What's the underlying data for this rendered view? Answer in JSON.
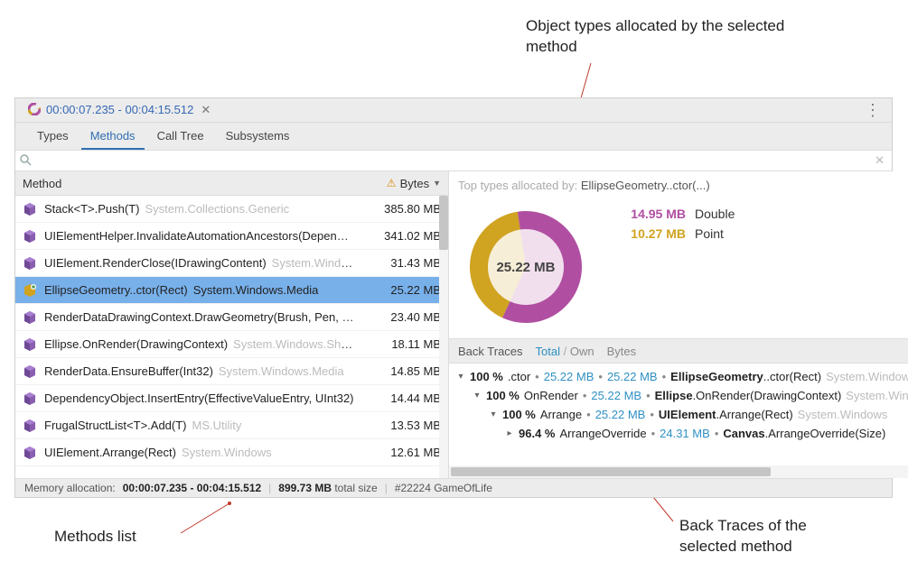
{
  "annotations": {
    "top_right": "Object types allocated by the selected method",
    "bottom_left": "Methods list",
    "bottom_right": "Back Traces of the selected method"
  },
  "tabstrip": {
    "title": "00:00:07.235 - 00:04:15.512"
  },
  "viewtabs": {
    "types": "Types",
    "methods": "Methods",
    "calltree": "Call Tree",
    "subsystems": "Subsystems"
  },
  "search": {
    "placeholder": ""
  },
  "grid_header": {
    "method": "Method",
    "bytes": "Bytes"
  },
  "methods": [
    {
      "name": "Stack<T>.Push(T)",
      "namespace": "System.Collections.Generic",
      "bytes": "385.80 MB",
      "selected": false
    },
    {
      "name": "UIElementHelper.InvalidateAutomationAncestors(DependencyObject)",
      "namespace": "",
      "bytes": "341.02 MB",
      "selected": false
    },
    {
      "name": "UIElement.RenderClose(IDrawingContent)",
      "namespace": "System.Windows",
      "bytes": "31.43 MB",
      "selected": false
    },
    {
      "name": "EllipseGeometry..ctor(Rect)",
      "namespace": "System.Windows.Media",
      "bytes": "25.22 MB",
      "selected": true
    },
    {
      "name": "RenderDataDrawingContext.DrawGeometry(Brush, Pen, Geometry)",
      "namespace": "",
      "bytes": "23.40 MB",
      "selected": false
    },
    {
      "name": "Ellipse.OnRender(DrawingContext)",
      "namespace": "System.Windows.Shapes",
      "bytes": "18.11 MB",
      "selected": false
    },
    {
      "name": "RenderData.EnsureBuffer(Int32)",
      "namespace": "System.Windows.Media",
      "bytes": "14.85 MB",
      "selected": false
    },
    {
      "name": "DependencyObject.InsertEntry(EffectiveValueEntry, UInt32)",
      "namespace": "",
      "bytes": "14.44 MB",
      "selected": false
    },
    {
      "name": "FrugalStructList<T>.Add(T)",
      "namespace": "MS.Utility",
      "bytes": "13.53 MB",
      "selected": false
    },
    {
      "name": "UIElement.Arrange(Rect)",
      "namespace": "System.Windows",
      "bytes": "12.61 MB",
      "selected": false
    }
  ],
  "statusbar": {
    "label": "Memory allocation:",
    "range": "00:00:07.235 - 00:04:15.512",
    "total_size": "899.73 MB",
    "total_size_suffix": "total size",
    "process": "#22224 GameOfLife"
  },
  "top_types": {
    "caption_prefix": "Top types allocated by:",
    "caption_selected": "EllipseGeometry..ctor(...)",
    "center": "25.22 MB",
    "legend": [
      {
        "value": "14.95 MB",
        "name": "Double",
        "color": "purple"
      },
      {
        "value": "10.27 MB",
        "name": "Point",
        "color": "yellow"
      }
    ]
  },
  "chart_data": {
    "type": "pie",
    "title": "Top types allocated by: EllipseGeometry..ctor(...)",
    "center_label": "25.22 MB",
    "unit": "MB",
    "series": [
      {
        "name": "Double",
        "value": 14.95,
        "color": "#b04fa1"
      },
      {
        "name": "Point",
        "value": 10.27,
        "color": "#d0a320"
      }
    ],
    "total": 25.22
  },
  "backtraces": {
    "header": {
      "label": "Back Traces",
      "total": "Total",
      "own": "Own",
      "bytes": "Bytes"
    },
    "rows": [
      {
        "indent": 0,
        "expander": "▾",
        "pct": "100 %",
        "short": ".ctor",
        "total": "25.22 MB",
        "own": "25.22 MB",
        "cls_bold": "EllipseGeometry",
        "cls_rest": "..ctor(Rect)",
        "ns": "System.Windows.Media"
      },
      {
        "indent": 1,
        "expander": "▾",
        "pct": "100 %",
        "short": "OnRender",
        "total": "25.22 MB",
        "own": "",
        "cls_bold": "Ellipse",
        "cls_rest": ".OnRender(DrawingContext)",
        "ns": "System.Windows.Shapes"
      },
      {
        "indent": 2,
        "expander": "▾",
        "pct": "100 %",
        "short": "Arrange",
        "total": "25.22 MB",
        "own": "",
        "cls_bold": "UIElement",
        "cls_rest": ".Arrange(Rect)",
        "ns": "System.Windows"
      },
      {
        "indent": 3,
        "expander": "▸",
        "pct": "96.4 %",
        "short": "ArrangeOverride",
        "total": "24.31 MB",
        "own": "",
        "cls_bold": "Canvas",
        "cls_rest": ".ArrangeOverride(Size)",
        "ns": ""
      }
    ]
  }
}
